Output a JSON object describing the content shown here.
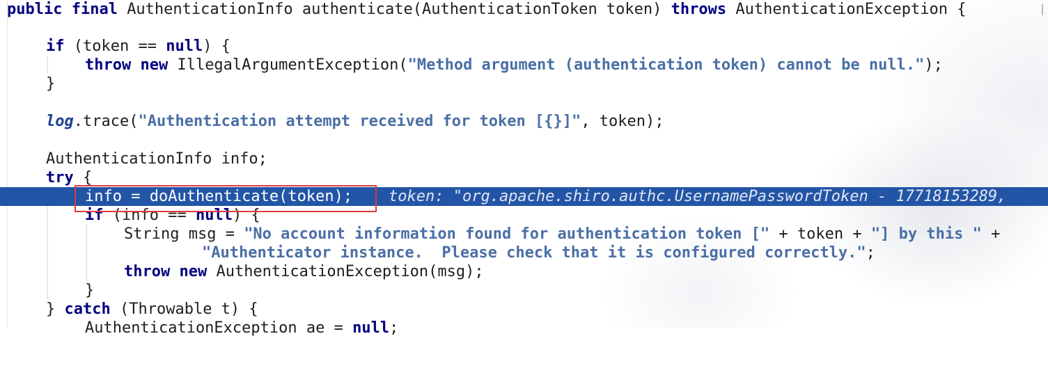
{
  "editor": {
    "lines": [
      {
        "id": "l1",
        "tokens": [
          [
            "kw",
            "public final "
          ],
          [
            "plain",
            "AuthenticationInfo authenticate(AuthenticationToken token) "
          ],
          [
            "kw",
            "throws "
          ],
          [
            "plain",
            "AuthenticationException {"
          ]
        ]
      },
      {
        "id": "l2",
        "tokens": []
      },
      {
        "id": "l3",
        "tokens": [
          [
            "kw",
            "if "
          ],
          [
            "plain",
            "(token == "
          ],
          [
            "kw",
            "null"
          ],
          [
            "plain",
            ") {"
          ]
        ]
      },
      {
        "id": "l4",
        "tokens": [
          [
            "kw",
            "throw new "
          ],
          [
            "plain",
            "IllegalArgumentException("
          ],
          [
            "str",
            "\"Method argument (authentication token) cannot be null.\""
          ],
          [
            "plain",
            ");"
          ]
        ]
      },
      {
        "id": "l5",
        "tokens": [
          [
            "plain",
            "}"
          ]
        ]
      },
      {
        "id": "l6",
        "tokens": []
      },
      {
        "id": "l7",
        "tokens": [
          [
            "field",
            "log"
          ],
          [
            "plain",
            ".trace("
          ],
          [
            "str",
            "\"Authentication attempt received for token [{}]\""
          ],
          [
            "plain",
            ", token);"
          ]
        ]
      },
      {
        "id": "l8",
        "tokens": []
      },
      {
        "id": "l9",
        "tokens": [
          [
            "plain",
            "AuthenticationInfo info;"
          ]
        ]
      },
      {
        "id": "l10",
        "tokens": [
          [
            "kw",
            "try "
          ],
          [
            "plain",
            "{"
          ]
        ]
      },
      {
        "id": "l11",
        "tokens": [
          [
            "plain",
            "info = doAuthenticate(token);"
          ]
        ],
        "hint": "token: \"org.apache.shiro.authc.UsernamePasswordToken - 17718153289,"
      },
      {
        "id": "l12",
        "tokens": [
          [
            "kw",
            "if "
          ],
          [
            "plain",
            "(info == "
          ],
          [
            "kw",
            "null"
          ],
          [
            "plain",
            ") {"
          ]
        ]
      },
      {
        "id": "l13",
        "tokens": [
          [
            "plain",
            "String msg = "
          ],
          [
            "str",
            "\"No account information found for authentication token [\""
          ],
          [
            "plain",
            " + token + "
          ],
          [
            "str",
            "\"] by this \""
          ],
          [
            "plain",
            " +"
          ]
        ]
      },
      {
        "id": "l14",
        "tokens": [
          [
            "str",
            "\"Authenticator instance.  Please check that it is configured correctly.\""
          ],
          [
            "plain",
            ";"
          ]
        ]
      },
      {
        "id": "l15",
        "tokens": [
          [
            "kw",
            "throw new "
          ],
          [
            "plain",
            "AuthenticationException(msg);"
          ]
        ]
      },
      {
        "id": "l16",
        "tokens": [
          [
            "plain",
            "}"
          ]
        ]
      },
      {
        "id": "l17",
        "tokens": [
          [
            "plain",
            "} "
          ],
          [
            "kw",
            "catch "
          ],
          [
            "plain",
            "(Throwable t) {"
          ]
        ]
      },
      {
        "id": "l18",
        "tokens": [
          [
            "plain",
            "AuthenticationException ae = "
          ],
          [
            "kw",
            "null"
          ],
          [
            "plain",
            ";"
          ]
        ]
      }
    ]
  },
  "colors": {
    "execution_line": "#2355a6",
    "breakpoint_box": "#e0393e"
  }
}
